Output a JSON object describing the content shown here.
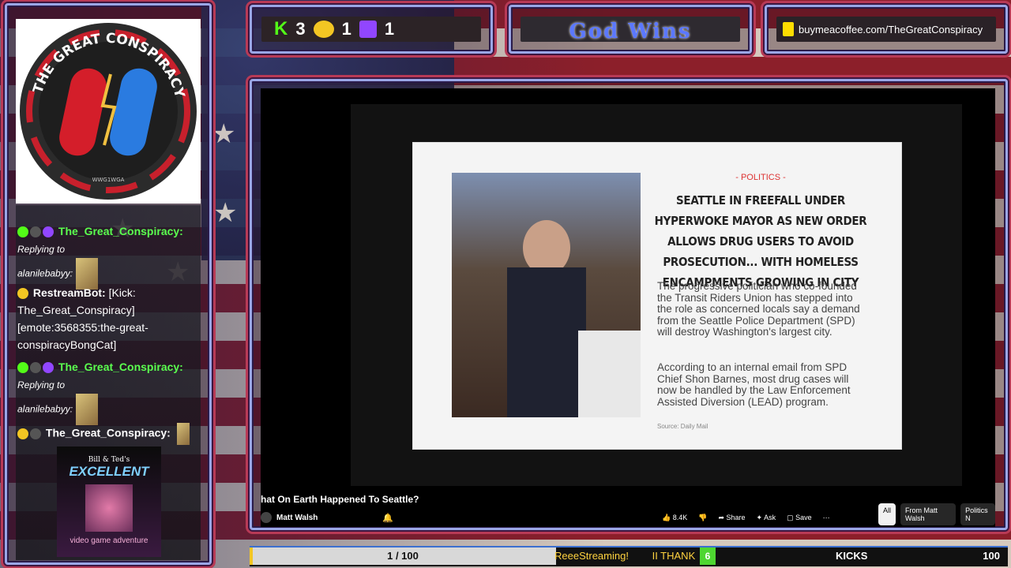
{
  "logo": {
    "title": "THE GREAT CONSPIRACY",
    "sub": "WWG1WGA"
  },
  "counters": {
    "kick": "3",
    "other": "1",
    "twitch": "1"
  },
  "banner": {
    "god_wins": "God Wins",
    "coffee_url": "buymeacoffee.com/TheGreatConspiracy"
  },
  "chat": {
    "m1_user": "The_Great_Conspiracy:",
    "m1_text": "Replying to",
    "m1_to": "alanilebabyy:",
    "m2_user": "RestreamBot:",
    "m2_text": "[Kick: The_Great_Conspiracy] [emote:3568355:the-great-conspiracyBongCat]",
    "m3_user": "The_Great_Conspiracy:",
    "m3_text": "Replying to",
    "m3_to": "alanilebabyy:",
    "m4_user": "The_Great_Conspiracy:",
    "gif_title": "EXCELLENT",
    "gif_top": "Bill & Ted's",
    "gif_bottom": "video game adventure"
  },
  "video": {
    "kicker": "- POLITICS -",
    "headline": "SEATTLE IN FREEFALL UNDER HYPERWOKE MAYOR AS NEW ORDER ALLOWS DRUG USERS TO AVOID PROSECUTION... WITH HOMELESS ENCAMPMENTS GROWING IN CITY",
    "p1": "The progressive politician who co-founded the Transit Riders Union has stepped into the role as concerned locals say a demand from the Seattle Police Department (SPD) will destroy Washington's largest city.",
    "p2": "According to an internal email from SPD Chief Shon Barnes, most drug cases will now be handled by the Law Enforcement Assisted Diversion (LEAD) program.",
    "source": "Source: Daily Mail",
    "title": "hat On Earth Happened To Seattle?",
    "channel": "Matt Walsh",
    "likes": "8.4K",
    "share": "Share",
    "ask": "Ask",
    "save": "Save",
    "chip_all": "All",
    "chip_from": "From Matt Walsh",
    "chip_politics": "Politics N"
  },
  "bottom": {
    "progress": "1 / 100",
    "ticker": "ReeeStreaming!",
    "ticker2": "II  THANK YO",
    "kick_count": "6",
    "kicks_label": "KICKS",
    "kicks_goal": "100"
  }
}
